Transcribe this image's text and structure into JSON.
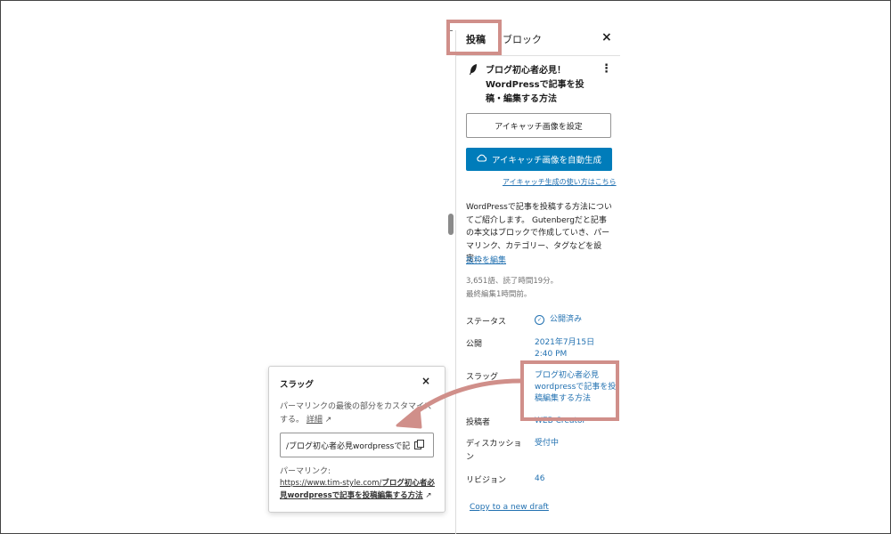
{
  "sidebar": {
    "tabs": {
      "post": "投稿",
      "block": "ブロック"
    },
    "close": "×",
    "post_title": "ブログ初心者必見！WordPressで記事を投稿・編集する方法",
    "post_icon": "feather-icon",
    "more_icon": "kebab-icon",
    "set_featured_label": "アイキャッチ画像を設定",
    "auto_generate_label": "アイキャッチ画像を自動生成",
    "auto_generate_icon": "cloud-icon",
    "help_link": "アイキャッチ生成の使い方はこちら",
    "excerpt": "WordPressで記事を投稿する方法についてご紹介します。 Gutenbergだと記事の本文はブロックで作成していき、パーマリンク、カテゴリー、タグなどを設定…",
    "edit_excerpt": "抜粋を編集",
    "stats_words": "3,651語、読了時間19分。",
    "stats_edited": "最終編集1時間前。",
    "rows": {
      "status_label": "ステータス",
      "status_value": "公開済み",
      "publish_label": "公開",
      "publish_date": "2021年7月15日",
      "publish_time": "2:40 PM",
      "slug_label": "スラッグ",
      "slug_value": "ブログ初心者必見wordpressで記事を投稿編集する方法",
      "author_label": "投稿者",
      "author_value": "WEB Creator",
      "discussion_label": "ディスカッション",
      "discussion_value": "受付中",
      "revisions_label": "リビジョン",
      "revisions_value": "46"
    },
    "copy_draft": "Copy to a new draft"
  },
  "popover": {
    "title": "スラッグ",
    "close": "×",
    "description": "パーマリンクの最後の部分をカスタマイズする。",
    "detail_link": "詳細",
    "slug_input_value": "/ブログ初心者必見wordpressで記",
    "copy_icon": "copy-icon",
    "permalink_label": "パーマリンク:",
    "permalink_base": "https://www.tim-style.com/",
    "permalink_slug": "ブログ初心者必見wordpressで記事を投稿編集する方法",
    "external_icon": "↗"
  },
  "colors": {
    "accent_blue": "#007cba",
    "link_blue": "#2271b1",
    "highlight": "#d08f8a",
    "tab_underline": "#3858e9"
  }
}
